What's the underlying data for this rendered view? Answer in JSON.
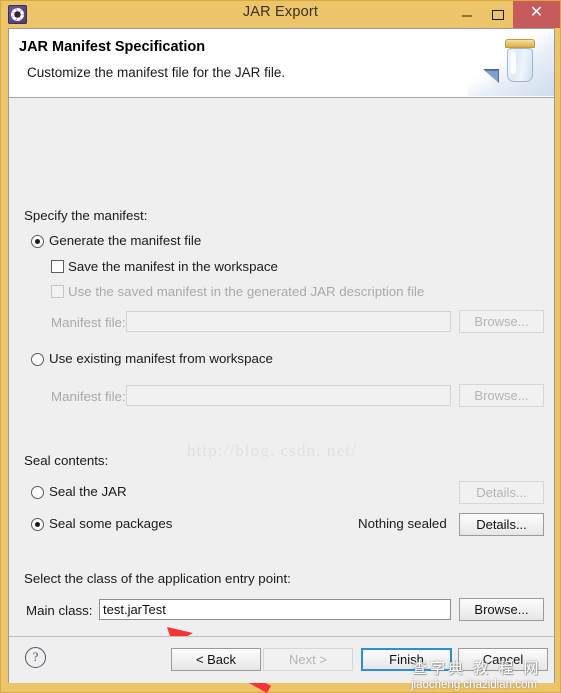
{
  "window": {
    "title": "JAR Export",
    "icon": "gear-icon",
    "frame_color": "#ecc56a",
    "controls": {
      "minimize": "–",
      "maximize": "□",
      "close": "✕",
      "close_color": "#c75b5b"
    }
  },
  "header": {
    "title": "JAR Manifest Specification",
    "description": "Customize the manifest file for the JAR file.",
    "banner_icon": "jar-icon"
  },
  "manifest_section": {
    "heading": "Specify the manifest:",
    "generate_option": {
      "label": "Generate the manifest file",
      "selected": true
    },
    "save_in_workspace": {
      "label": "Save the manifest in the workspace",
      "checked": false,
      "enabled": true
    },
    "use_saved_manifest": {
      "label": "Use the saved manifest in the generated JAR description file",
      "checked": false,
      "enabled": false
    },
    "generate_manifest_file": {
      "label": "Manifest file:",
      "value": "",
      "enabled": false,
      "browse_label": "Browse..."
    },
    "existing_option": {
      "label": "Use existing manifest from workspace",
      "selected": false
    },
    "existing_manifest_file": {
      "label": "Manifest file:",
      "value": "",
      "enabled": false,
      "browse_label": "Browse..."
    }
  },
  "seal_section": {
    "heading": "Seal contents:",
    "seal_jar": {
      "label": "Seal the JAR",
      "selected": false,
      "details_label": "Details...",
      "details_enabled": false
    },
    "seal_some": {
      "label": "Seal some packages",
      "selected": true,
      "status": "Nothing sealed",
      "details_label": "Details...",
      "details_enabled": true
    }
  },
  "entry_point_section": {
    "heading": "Select the class of the application entry point:",
    "main_class_label": "Main class:",
    "main_class_value": "test.jarTest",
    "browse_label": "Browse..."
  },
  "footer": {
    "help_icon": "question-mark-icon",
    "buttons": [
      {
        "label": "< Back",
        "enabled": true,
        "default": false
      },
      {
        "label": "Next >",
        "enabled": false,
        "default": false
      },
      {
        "label": "Finish",
        "enabled": true,
        "default": true
      },
      {
        "label": "Cancel",
        "enabled": true,
        "default": false
      }
    ]
  },
  "annotations": {
    "arrow_color": "#f73434",
    "watermark_url": "http://blog. csdn. net/",
    "watermark_site_cn": "查字典 教 程 网",
    "watermark_site_en": "jiaocheng.chazidian.com"
  }
}
